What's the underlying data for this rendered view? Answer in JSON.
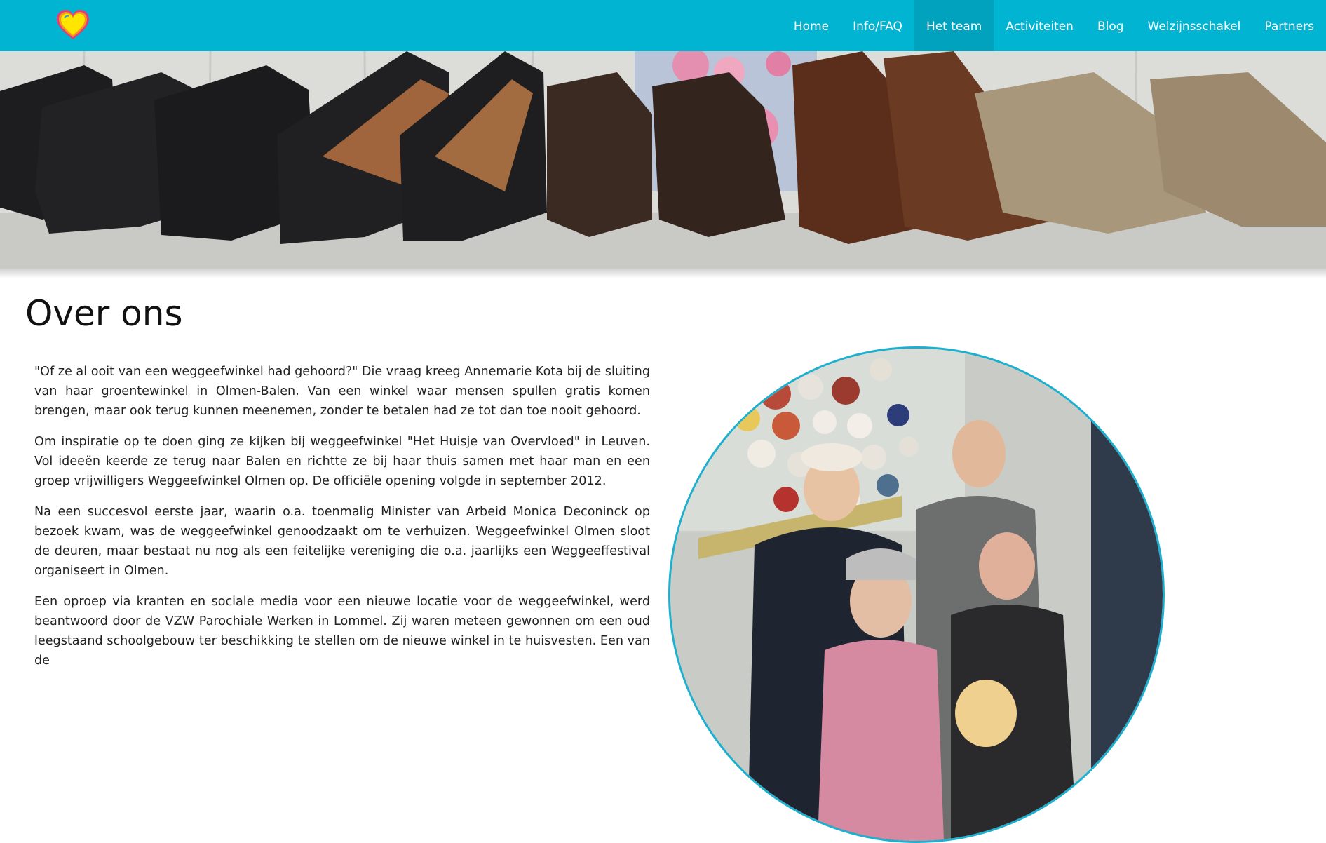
{
  "header": {
    "logo_name": "heart-logo",
    "colors": {
      "bar": "#00b4d2",
      "active": "#00a2bd",
      "text": "#ffffff"
    },
    "nav": [
      {
        "label": "Home",
        "active": false
      },
      {
        "label": "Info/FAQ",
        "active": false
      },
      {
        "label": "Het team",
        "active": true
      },
      {
        "label": "Activiteiten",
        "active": false
      },
      {
        "label": "Blog",
        "active": false
      },
      {
        "label": "Welzijnsschakel",
        "active": false
      },
      {
        "label": "Partners",
        "active": false
      }
    ]
  },
  "main": {
    "title": "Over ons",
    "paragraphs": [
      "\"Of ze al ooit van een weggeefwinkel had gehoord?\" Die vraag kreeg Annemarie Kota bij de sluiting van haar groentewinkel in Olmen-Balen. Van een winkel waar mensen spullen gratis komen brengen, maar ook terug kunnen meenemen, zonder te betalen had ze tot dan toe nooit gehoord.",
      "Om inspiratie op te doen ging ze kijken bij weggeefwinkel \"Het Huisje van Overvloed\" in Leuven. Vol ideeën keerde ze terug naar Balen en richtte ze bij haar thuis samen met haar man en een groep vrijwilligers Weggeefwinkel Olmen op. De officiële opening volgde in september 2012.",
      "Na een succesvol eerste jaar, waarin o.a. toenmalig Minister van Arbeid Monica Deconinck op bezoek kwam, was de weggeefwinkel genoodzaakt om te verhuizen. Weggeefwinkel Olmen sloot de deuren, maar bestaat nu nog als een feitelijke vereniging die o.a. jaarlijks een Weggeeffestival organiseert in Olmen.",
      "Een oproep via kranten en sociale media voor een nieuwe locatie voor de weggeefwinkel, werd beantwoord door de VZW Parochiale Werken in Lommel. Zij waren meteen gewonnen om een oud leegstaand schoolgebouw ter beschikking te stellen om de nieuwe winkel in te huisvesten. Een van de"
    ]
  }
}
